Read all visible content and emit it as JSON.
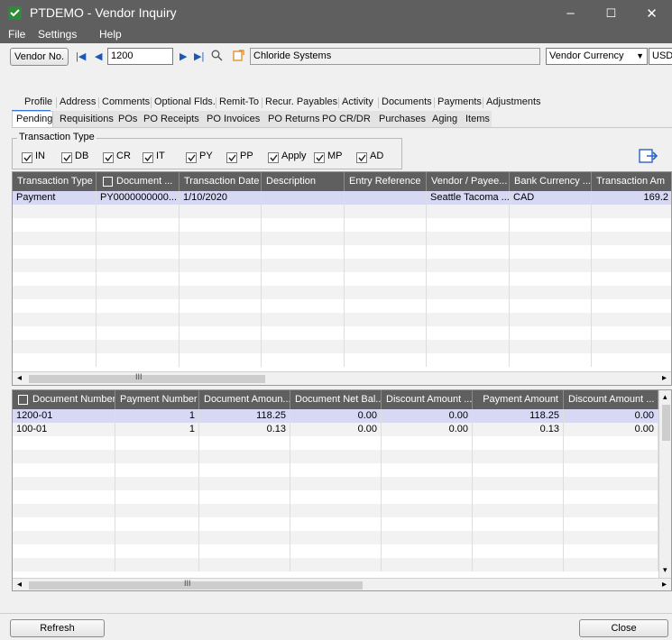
{
  "window": {
    "title": "PTDEMO - Vendor Inquiry",
    "minimize": "–",
    "maximize": "☐",
    "close": "✕"
  },
  "menu": {
    "file": "File",
    "settings": "Settings",
    "help": "Help"
  },
  "vendor": {
    "button_label": "Vendor No.",
    "number": "1200",
    "name": "Chloride Systems",
    "currency_mode": "Vendor Currency",
    "currency": "USD"
  },
  "tabs_row1": [
    "Profile",
    "Address",
    "Comments",
    "Optional Flds.",
    "Remit-To",
    "Recur. Payables",
    "Activity",
    "Documents",
    "Payments",
    "Adjustments"
  ],
  "tabs_row2": [
    "Pending",
    "Requisitions",
    "POs",
    "PO Receipts",
    "PO Invoices",
    "PO Returns",
    "PO CR/DR",
    "Purchases",
    "Aging",
    "Items"
  ],
  "transaction_type": {
    "label": "Transaction Type",
    "options": [
      "IN",
      "DB",
      "CR",
      "IT",
      "PY",
      "PP",
      "Apply",
      "MP",
      "AD"
    ]
  },
  "top_grid": {
    "columns": [
      "Transaction Type",
      "Document ...",
      "Transaction Date",
      "Description",
      "Entry Reference",
      "Vendor / Payee...",
      "Bank Currency ...",
      "Transaction Am"
    ],
    "rows": [
      [
        "Payment",
        "PY0000000000...",
        "1/10/2020",
        "",
        "",
        "Seattle Tacoma ...",
        "CAD",
        "169.2"
      ]
    ]
  },
  "bottom_grid": {
    "columns": [
      "Document Number",
      "Payment Number",
      "Document Amoun...",
      "Document Net Bal...",
      "Discount Amount ...",
      "Payment Amount",
      "Discount Amount ..."
    ],
    "rows": [
      [
        "1200-01",
        "1",
        "118.25",
        "0.00",
        "0.00",
        "118.25",
        "0.00"
      ],
      [
        "100-01",
        "1",
        "0.13",
        "0.00",
        "0.00",
        "0.13",
        "0.00"
      ]
    ]
  },
  "scroll": {
    "dots": "III"
  },
  "footer": {
    "refresh": "Refresh",
    "close": "Close"
  },
  "colors": {
    "titlebar": "#5f5f5f",
    "selected_row": "#d6d8f4",
    "active_tab_underline": "#3c78d8"
  }
}
